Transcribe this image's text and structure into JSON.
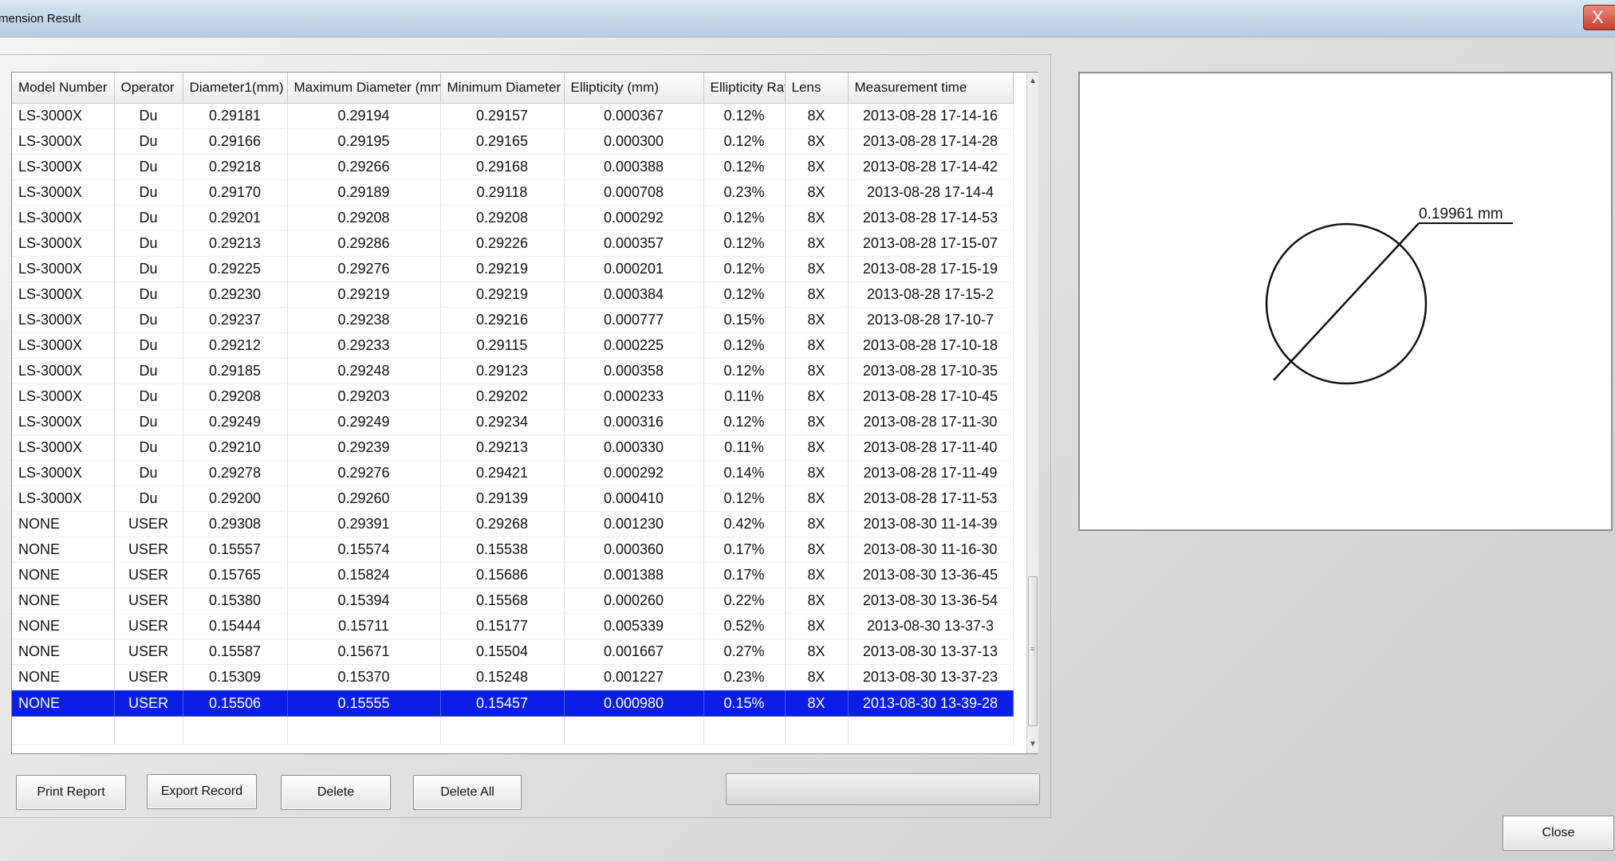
{
  "window": {
    "title": "mension Result",
    "close_glyph": "X"
  },
  "grid": {
    "columns": [
      "Model Number",
      "Operator",
      "Diameter1(mm)",
      "Maximum Diameter (mm)",
      "Minimum Diameter (mm)",
      "Ellipticity (mm)",
      "Ellipticity Ratio (%)",
      "Lens",
      "Measurement time"
    ],
    "rows": [
      [
        "LS-3000X",
        "Du",
        "0.29181",
        "0.29194",
        "0.29157",
        "0.000367",
        "0.12%",
        "8X",
        "2013-08-28 17-14-16"
      ],
      [
        "LS-3000X",
        "Du",
        "0.29166",
        "0.29195",
        "0.29165",
        "0.000300",
        "0.12%",
        "8X",
        "2013-08-28 17-14-28"
      ],
      [
        "LS-3000X",
        "Du",
        "0.29218",
        "0.29266",
        "0.29168",
        "0.000388",
        "0.12%",
        "8X",
        "2013-08-28 17-14-42"
      ],
      [
        "LS-3000X",
        "Du",
        "0.29170",
        "0.29189",
        "0.29118",
        "0.000708",
        "0.23%",
        "8X",
        "2013-08-28 17-14-4"
      ],
      [
        "LS-3000X",
        "Du",
        "0.29201",
        "0.29208",
        "0.29208",
        "0.000292",
        "0.12%",
        "8X",
        "2013-08-28 17-14-53"
      ],
      [
        "LS-3000X",
        "Du",
        "0.29213",
        "0.29286",
        "0.29226",
        "0.000357",
        "0.12%",
        "8X",
        "2013-08-28 17-15-07"
      ],
      [
        "LS-3000X",
        "Du",
        "0.29225",
        "0.29276",
        "0.29219",
        "0.000201",
        "0.12%",
        "8X",
        "2013-08-28 17-15-19"
      ],
      [
        "LS-3000X",
        "Du",
        "0.29230",
        "0.29219",
        "0.29219",
        "0.000384",
        "0.12%",
        "8X",
        "2013-08-28 17-15-2"
      ],
      [
        "LS-3000X",
        "Du",
        "0.29237",
        "0.29238",
        "0.29216",
        "0.000777",
        "0.15%",
        "8X",
        "2013-08-28 17-10-7"
      ],
      [
        "LS-3000X",
        "Du",
        "0.29212",
        "0.29233",
        "0.29115",
        "0.000225",
        "0.12%",
        "8X",
        "2013-08-28 17-10-18"
      ],
      [
        "LS-3000X",
        "Du",
        "0.29185",
        "0.29248",
        "0.29123",
        "0.000358",
        "0.12%",
        "8X",
        "2013-08-28 17-10-35"
      ],
      [
        "LS-3000X",
        "Du",
        "0.29208",
        "0.29203",
        "0.29202",
        "0.000233",
        "0.11%",
        "8X",
        "2013-08-28 17-10-45"
      ],
      [
        "LS-3000X",
        "Du",
        "0.29249",
        "0.29249",
        "0.29234",
        "0.000316",
        "0.12%",
        "8X",
        "2013-08-28 17-11-30"
      ],
      [
        "LS-3000X",
        "Du",
        "0.29210",
        "0.29239",
        "0.29213",
        "0.000330",
        "0.11%",
        "8X",
        "2013-08-28 17-11-40"
      ],
      [
        "LS-3000X",
        "Du",
        "0.29278",
        "0.29276",
        "0.29421",
        "0.000292",
        "0.14%",
        "8X",
        "2013-08-28 17-11-49"
      ],
      [
        "LS-3000X",
        "Du",
        "0.29200",
        "0.29260",
        "0.29139",
        "0.000410",
        "0.12%",
        "8X",
        "2013-08-28 17-11-53"
      ],
      [
        "NONE",
        "USER",
        "0.29308",
        "0.29391",
        "0.29268",
        "0.001230",
        "0.42%",
        "8X",
        "2013-08-30 11-14-39"
      ],
      [
        "NONE",
        "USER",
        "0.15557",
        "0.15574",
        "0.15538",
        "0.000360",
        "0.17%",
        "8X",
        "2013-08-30 11-16-30"
      ],
      [
        "NONE",
        "USER",
        "0.15765",
        "0.15824",
        "0.15686",
        "0.001388",
        "0.17%",
        "8X",
        "2013-08-30 13-36-45"
      ],
      [
        "NONE",
        "USER",
        "0.15380",
        "0.15394",
        "0.15568",
        "0.000260",
        "0.22%",
        "8X",
        "2013-08-30 13-36-54"
      ],
      [
        "NONE",
        "USER",
        "0.15444",
        "0.15711",
        "0.15177",
        "0.005339",
        "0.52%",
        "8X",
        "2013-08-30 13-37-3"
      ],
      [
        "NONE",
        "USER",
        "0.15587",
        "0.15671",
        "0.15504",
        "0.001667",
        "0.27%",
        "8X",
        "2013-08-30 13-37-13"
      ],
      [
        "NONE",
        "USER",
        "0.15309",
        "0.15370",
        "0.15248",
        "0.001227",
        "0.23%",
        "8X",
        "2013-08-30 13-37-23"
      ],
      [
        "NONE",
        "USER",
        "0.15506",
        "0.15555",
        "0.15457",
        "0.000980",
        "0.15%",
        "8X",
        "2013-08-30 13-39-28"
      ]
    ],
    "selected_row_index": 23,
    "selection_color": "#0a1ee6"
  },
  "buttons": {
    "print_report": "Print Report",
    "export_record": "Export Record",
    "delete": "Delete",
    "delete_all": "Delete All",
    "close": "Close"
  },
  "preview": {
    "dimension_label": "0.19961 mm"
  }
}
